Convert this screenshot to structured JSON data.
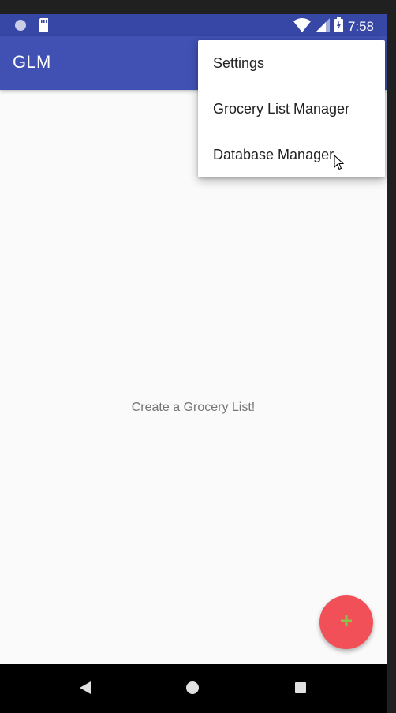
{
  "status_bar": {
    "time": "7:58",
    "icons": [
      "notification-dot-icon",
      "sd-card-icon",
      "wifi-icon",
      "signal-icon",
      "battery-charging-icon"
    ]
  },
  "app_bar": {
    "title": "GLM"
  },
  "overflow_menu": {
    "items": [
      {
        "label": "Settings"
      },
      {
        "label": "Grocery List Manager"
      },
      {
        "label": "Database Manager"
      }
    ]
  },
  "main": {
    "empty_message": "Create a Grocery List!"
  },
  "fab": {
    "icon": "plus-icon"
  },
  "nav_bar": {
    "icons": [
      "back-icon",
      "home-icon",
      "recents-icon"
    ]
  },
  "colors": {
    "status_bar": "#3747a6",
    "app_bar": "#4151b3",
    "fab": "#f25058",
    "fab_icon": "#8bc34a",
    "background": "#fafafa"
  }
}
